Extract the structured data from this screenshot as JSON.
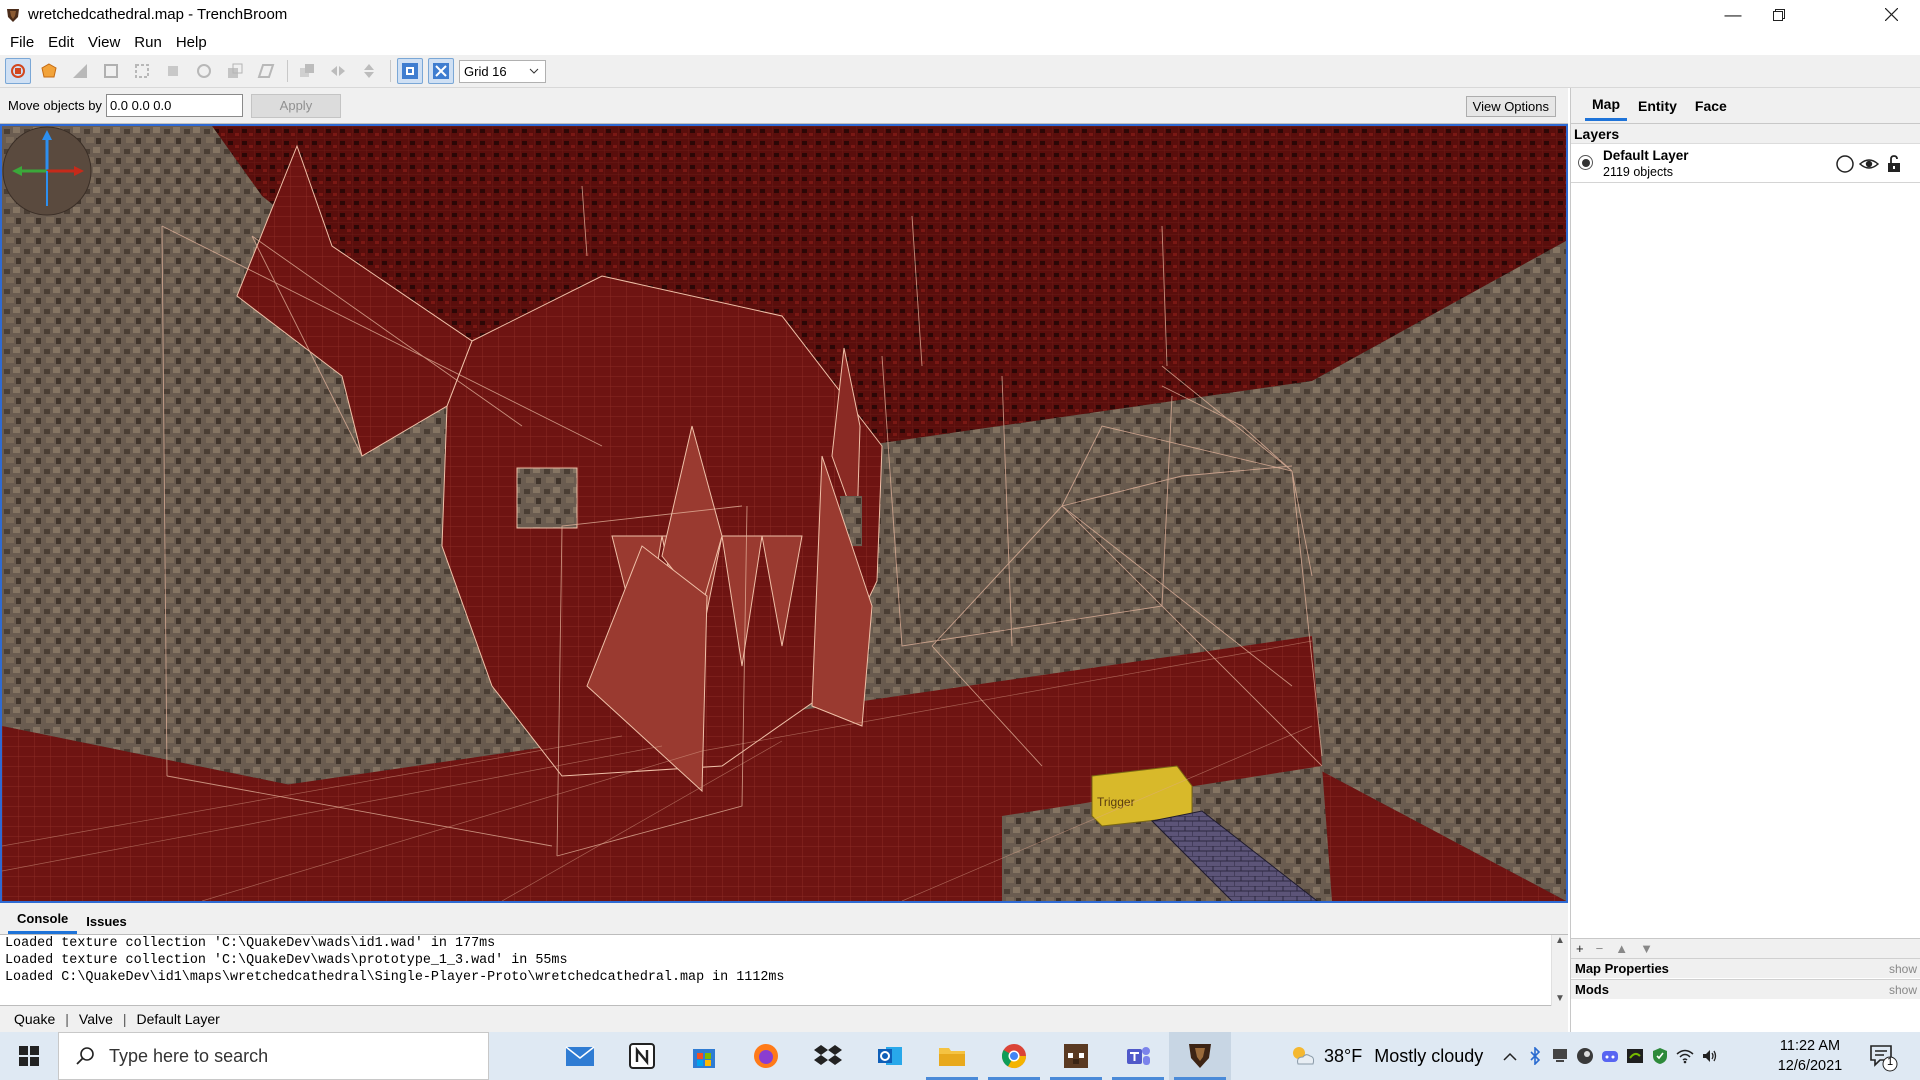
{
  "window": {
    "title": "wretchedcathedral.map - TrenchBroom",
    "controls": [
      "minimize",
      "restore",
      "close"
    ]
  },
  "menu": [
    "File",
    "Edit",
    "View",
    "Run",
    "Help"
  ],
  "toolbar": {
    "grid_label": "Grid 16",
    "tools": [
      "select-tool",
      "brush-tool",
      "clip-tool",
      "vertex-tool",
      "edge-tool",
      "face-tool",
      "rotate-tool",
      "scale-tool",
      "shear-tool",
      "duplicate-tool",
      "flip-horizontal-tool",
      "flip-vertical-tool",
      "texture-lock-toggle",
      "uv-lock-toggle"
    ]
  },
  "move_bar": {
    "label": "Move objects by",
    "value": "0.0 0.0 0.0",
    "apply_label": "Apply",
    "view_options_label": "View Options"
  },
  "viewport": {
    "trigger_text": "Trigger",
    "colors": {
      "floor": "#6a1210",
      "wall": "#5f5348",
      "ceiling": "#4a0e0c",
      "wire": "#e8b8a0",
      "selection": "#2f6ad3"
    }
  },
  "console": {
    "tabs": [
      "Console",
      "Issues"
    ],
    "active_tab": "Console",
    "lines": [
      "Loaded texture collection 'C:\\QuakeDev\\wads\\id1.wad' in 177ms",
      "Loaded texture collection 'C:\\QuakeDev\\wads\\prototype_1_3.wad' in 55ms",
      "Loaded C:\\QuakeDev\\id1\\maps\\wretchedcathedral\\Single-Player-Proto\\wretchedcathedral.map in 1112ms"
    ]
  },
  "status": {
    "game": "Quake",
    "format": "Valve",
    "layer": "Default Layer"
  },
  "right_panel": {
    "tabs": [
      "Map",
      "Entity",
      "Face"
    ],
    "active_tab": "Map",
    "layers_header": "Layers",
    "layer": {
      "name": "Default Layer",
      "count": "2119 objects"
    },
    "layer_buttons": [
      "+",
      "−",
      "▲",
      "▼"
    ],
    "sections": [
      {
        "title": "Map Properties",
        "action": "show"
      },
      {
        "title": "Mods",
        "action": "show"
      }
    ]
  },
  "taskbar": {
    "search_placeholder": "Type here to search",
    "apps": [
      "mail-icon",
      "notion-icon",
      "store-icon",
      "firefox-icon",
      "dropbox-icon",
      "outlook-icon",
      "explorer-icon",
      "chrome-icon",
      "minecraft-icon",
      "teams-icon",
      "trenchbroom-icon"
    ],
    "weather_temp": "38°F",
    "weather_text": "Mostly cloudy",
    "time": "11:22 AM",
    "date": "12/6/2021",
    "notification_count": "1"
  }
}
